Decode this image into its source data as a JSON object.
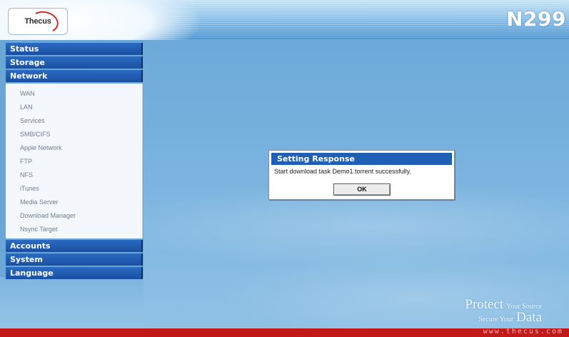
{
  "header": {
    "logo_text": "Thecus",
    "model": "N299"
  },
  "sidebar": {
    "categories": [
      {
        "label": "Status"
      },
      {
        "label": "Storage"
      },
      {
        "label": "Network",
        "items": [
          "WAN",
          "LAN",
          "Services",
          "SMB/CIFS",
          "Apple Network",
          "FTP",
          "NFS",
          "iTunes",
          "Media Server",
          "Download Manager",
          "Nsync Target"
        ]
      },
      {
        "label": "Accounts"
      },
      {
        "label": "System"
      },
      {
        "label": "Language"
      }
    ]
  },
  "dialog": {
    "title": "Setting Response",
    "message": "Start download task Demo1.torrent successfully.",
    "ok_label": "OK"
  },
  "tagline": {
    "protect": "Protect",
    "your_source": "Your Source",
    "secure_your": "Secure Your",
    "data": "Data"
  },
  "footer": {
    "url": "www.thecus.com"
  },
  "colors": {
    "category_bg": "#1f5fb4",
    "footer_red": "#c21818"
  }
}
